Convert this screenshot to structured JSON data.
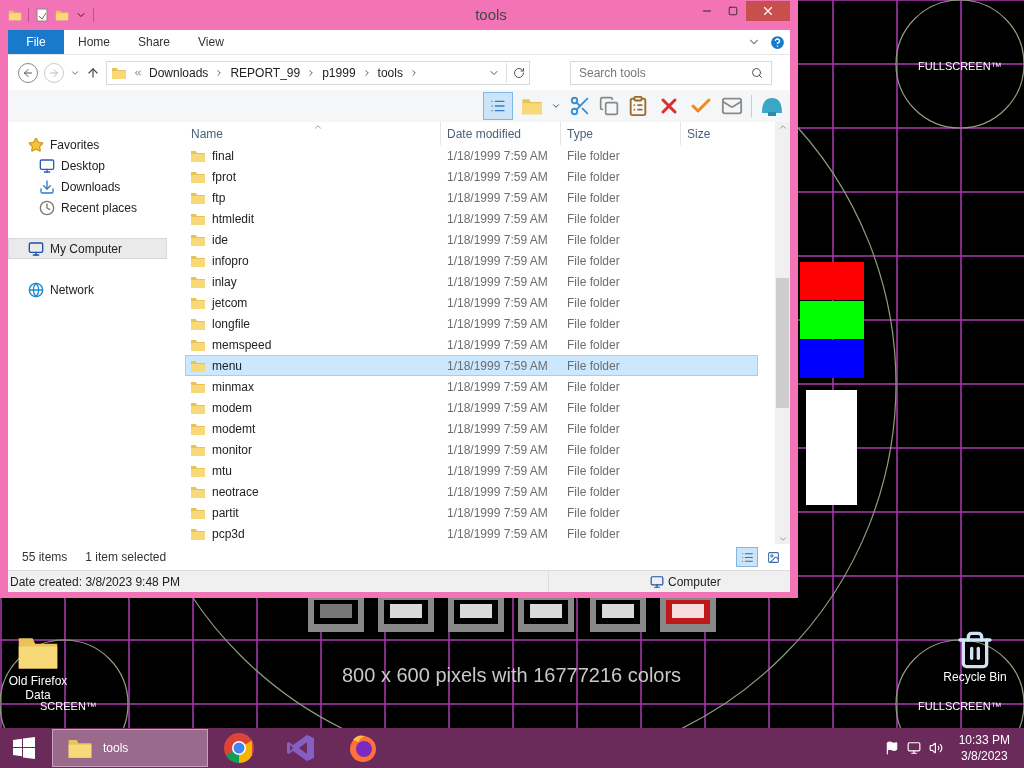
{
  "window": {
    "title": "tools",
    "ribbon_tabs": [
      {
        "label": "File",
        "selected": true
      },
      {
        "label": "Home",
        "selected": false
      },
      {
        "label": "Share",
        "selected": false
      },
      {
        "label": "View",
        "selected": false
      }
    ],
    "address": {
      "path": [
        "Downloads",
        "REPORT_99",
        "p1999",
        "tools"
      ]
    },
    "search": {
      "placeholder": "Search tools"
    },
    "nav": [
      {
        "label": "Favorites",
        "kind": "favorites",
        "selected": false,
        "children": [
          {
            "label": "Desktop",
            "kind": "desktop",
            "selected": false
          },
          {
            "label": "Downloads",
            "kind": "downloads",
            "selected": false
          },
          {
            "label": "Recent places",
            "kind": "recent",
            "selected": false
          }
        ]
      },
      {
        "label": "My Computer",
        "kind": "computer",
        "selected": true
      },
      {
        "label": "Network",
        "kind": "network",
        "selected": false
      }
    ],
    "columns": [
      "Name",
      "Date modified",
      "Type",
      "Size"
    ],
    "rows": [
      {
        "name": "final",
        "date": "1/18/1999 7:59 AM",
        "type": "File folder",
        "selected": false
      },
      {
        "name": "fprot",
        "date": "1/18/1999 7:59 AM",
        "type": "File folder",
        "selected": false
      },
      {
        "name": "ftp",
        "date": "1/18/1999 7:59 AM",
        "type": "File folder",
        "selected": false
      },
      {
        "name": "htmledit",
        "date": "1/18/1999 7:59 AM",
        "type": "File folder",
        "selected": false
      },
      {
        "name": "ide",
        "date": "1/18/1999 7:59 AM",
        "type": "File folder",
        "selected": false
      },
      {
        "name": "infopro",
        "date": "1/18/1999 7:59 AM",
        "type": "File folder",
        "selected": false
      },
      {
        "name": "inlay",
        "date": "1/18/1999 7:59 AM",
        "type": "File folder",
        "selected": false
      },
      {
        "name": "jetcom",
        "date": "1/18/1999 7:59 AM",
        "type": "File folder",
        "selected": false
      },
      {
        "name": "longfile",
        "date": "1/18/1999 7:59 AM",
        "type": "File folder",
        "selected": false
      },
      {
        "name": "memspeed",
        "date": "1/18/1999 7:59 AM",
        "type": "File folder",
        "selected": false
      },
      {
        "name": "menu",
        "date": "1/18/1999 7:59 AM",
        "type": "File folder",
        "selected": true
      },
      {
        "name": "minmax",
        "date": "1/18/1999 7:59 AM",
        "type": "File folder",
        "selected": false
      },
      {
        "name": "modem",
        "date": "1/18/1999 7:59 AM",
        "type": "File folder",
        "selected": false
      },
      {
        "name": "modemt",
        "date": "1/18/1999 7:59 AM",
        "type": "File folder",
        "selected": false
      },
      {
        "name": "monitor",
        "date": "1/18/1999 7:59 AM",
        "type": "File folder",
        "selected": false
      },
      {
        "name": "mtu",
        "date": "1/18/1999 7:59 AM",
        "type": "File folder",
        "selected": false
      },
      {
        "name": "neotrace",
        "date": "1/18/1999 7:59 AM",
        "type": "File folder",
        "selected": false
      },
      {
        "name": "partit",
        "date": "1/18/1999 7:59 AM",
        "type": "File folder",
        "selected": false
      },
      {
        "name": "pcp3d",
        "date": "1/18/1999 7:59 AM",
        "type": "File folder",
        "selected": false
      }
    ],
    "item_count": "55 items",
    "selection_count": "1 item selected",
    "views": [
      {
        "kind": "details",
        "selected": true
      },
      {
        "kind": "large",
        "selected": false
      }
    ],
    "status": {
      "date_created": "Date created: 3/8/2023 9:48 PM",
      "location": "Computer"
    }
  },
  "desktop": {
    "wallpaper_labels": [
      "FULLSCREEN™",
      "SCREEN™",
      "FULLSCREEN™"
    ],
    "caption": "800 x 600 pixels with 16777216 colors",
    "icons": [
      {
        "label": "Old Firefox Data",
        "kind": "folder"
      },
      {
        "label": "Recycle Bin",
        "kind": "bin"
      }
    ]
  },
  "taskbar": {
    "items": [
      {
        "kind": "folder",
        "label": "tools",
        "selected": true
      },
      {
        "kind": "chrome",
        "selected": false
      },
      {
        "kind": "studio",
        "selected": false
      },
      {
        "kind": "firefox",
        "selected": false
      }
    ],
    "time": "10:33 PM",
    "date": "3/8/2023"
  }
}
